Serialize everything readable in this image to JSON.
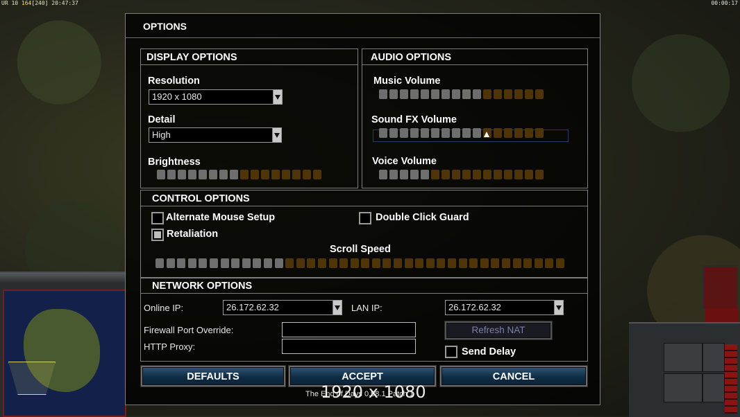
{
  "hud": {
    "top_left_prefix": "UR 10",
    "top_left_highlight": "164",
    "top_left_bracket": "[240]",
    "top_left_time": "20:47:37",
    "top_right_time": "00:00:17",
    "rank_stars": "★★★"
  },
  "window": {
    "title": "OPTIONS"
  },
  "display": {
    "header": "DISPLAY OPTIONS",
    "resolution_label": "Resolution",
    "resolution_value": "1920 x 1080",
    "detail_label": "Detail",
    "detail_value": "High",
    "brightness_label": "Brightness",
    "brightness_level": {
      "filled": 8,
      "total": 16
    }
  },
  "audio": {
    "header": "AUDIO OPTIONS",
    "music_label": "Music Volume",
    "music_level": {
      "filled": 10,
      "total": 16
    },
    "sfx_label": "Sound FX Volume",
    "sfx_level": {
      "filled": 10,
      "total": 16
    },
    "voice_label": "Voice Volume",
    "voice_level": {
      "filled": 5,
      "total": 16
    }
  },
  "control": {
    "header": "CONTROL OPTIONS",
    "alt_mouse_label": "Alternate Mouse Setup",
    "alt_mouse_checked": false,
    "double_click_label": "Double Click Guard",
    "double_click_checked": false,
    "retaliation_label": "Retaliation",
    "retaliation_checked": true,
    "scroll_label": "Scroll Speed",
    "scroll_level": {
      "filled": 12,
      "total": 38
    }
  },
  "network": {
    "header": "NETWORK OPTIONS",
    "online_ip_label": "Online IP:",
    "online_ip_value": "26.172.62.32",
    "lan_ip_label": "LAN IP:",
    "lan_ip_value": "26.172.62.32",
    "firewall_label": "Firewall Port Override:",
    "firewall_value": "",
    "http_proxy_label": "HTTP Proxy:",
    "http_proxy_value": "",
    "refresh_nat_label": "Refresh NAT",
    "send_delay_label": "Send Delay",
    "send_delay_checked": false
  },
  "buttons": {
    "defaults": "DEFAULTS",
    "accept": "ACCEPT",
    "cancel": "CANCEL"
  },
  "footer": {
    "version_text": "The End of Days 0.98.1 Patch 1",
    "resolution_overlay": "1920 x 1080"
  }
}
